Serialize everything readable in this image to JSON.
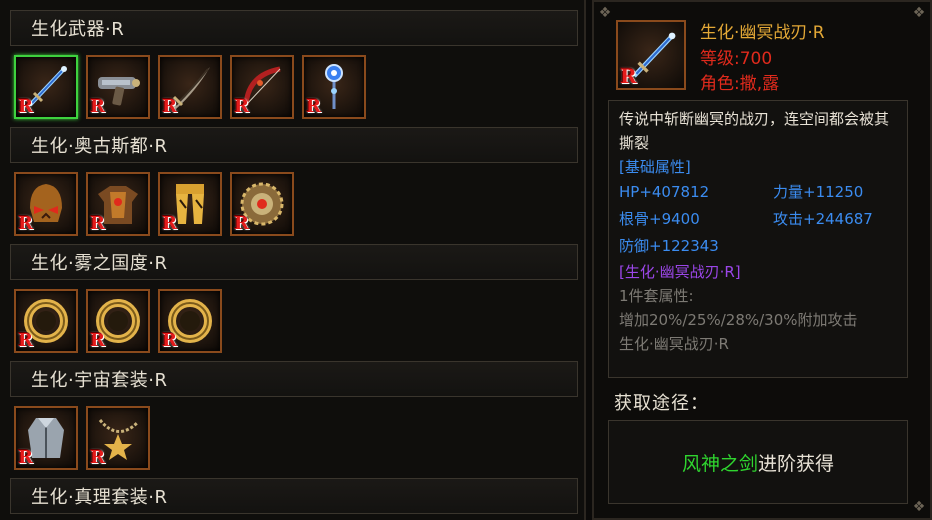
{
  "sets": [
    {
      "title": "生化武器·R",
      "items": [
        "blue-sword",
        "blaster-gun",
        "dark-blade",
        "red-bow",
        "crystal-staff"
      ],
      "selected_index": 0
    },
    {
      "title": "生化·奥古斯都·R",
      "items": [
        "demon-helmet",
        "spiked-armor",
        "gold-greaves",
        "sun-medallion"
      ]
    },
    {
      "title": "生化·雾之国度·R",
      "items": [
        "gold-ring",
        "gold-ring",
        "gold-ring"
      ]
    },
    {
      "title": "生化·宇宙套装·R",
      "items": [
        "long-coat",
        "star-necklace"
      ]
    },
    {
      "title": "生化·真理套装·R",
      "items": []
    }
  ],
  "rarity_badge": "R",
  "detail": {
    "name": "生化·幽冥战刃·R",
    "level": "等级:700",
    "role": "角色:撒,露",
    "description": "传说中斩断幽冥的战刃，连空间都会被其撕裂",
    "attr_title": "[基础属性]",
    "attrs": [
      "HP+407812",
      "力量+11250",
      "根骨+9400",
      "攻击+244687",
      "防御+122343"
    ],
    "set_name": "[生化·幽冥战刃·R]",
    "set_label": "1件套属性:",
    "set_bonus": "增加20%/25%/28%/30%附加攻击",
    "set_tail": "生化·幽冥战刃·R"
  },
  "obtain": {
    "title": "获取途径：",
    "link": "风神之剑",
    "rest": "进阶获得"
  },
  "colors": {
    "name": "#e3a836",
    "level": "#e02a1c",
    "attr": "#3b8cf0",
    "set": "#9b46e8",
    "link": "#2fd52f",
    "slot_border": "#8a4a1c",
    "selected_border": "#3ed23e"
  }
}
